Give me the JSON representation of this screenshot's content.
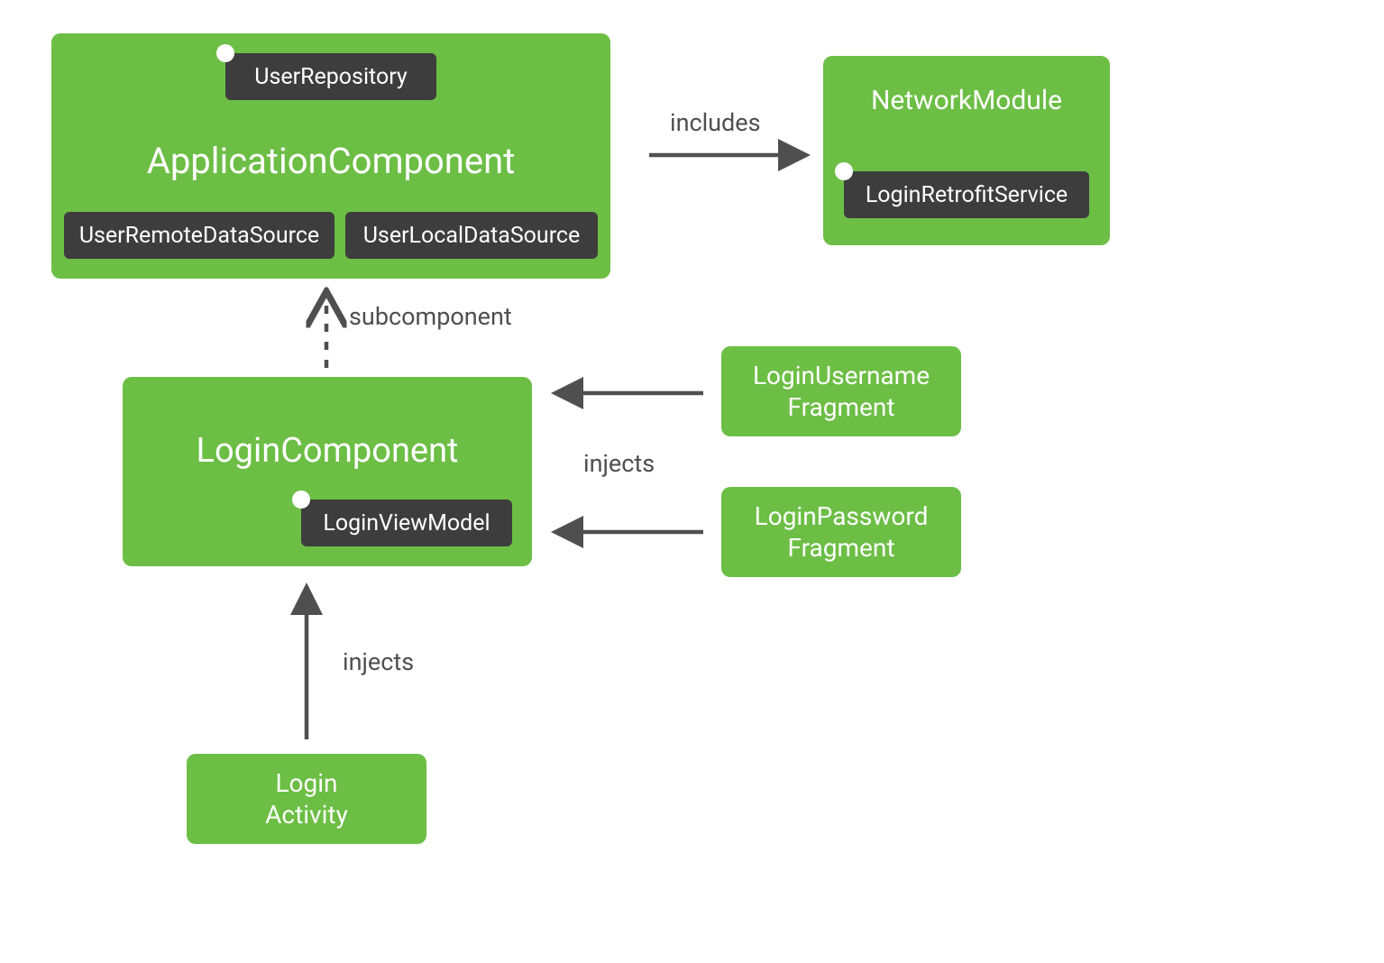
{
  "colors": {
    "green": "#6cbe45",
    "chip": "#3d3d3d",
    "label": "#4f4f4f",
    "arrow": "#4f4f4f"
  },
  "nodes": {
    "applicationComponent": {
      "title": "ApplicationComponent",
      "chips": {
        "userRepository": "UserRepository",
        "userRemoteDataSource": "UserRemoteDataSource",
        "userLocalDataSource": "UserLocalDataSource"
      }
    },
    "networkModule": {
      "title": "NetworkModule",
      "chips": {
        "loginRetrofitService": "LoginRetrofitService"
      }
    },
    "loginComponent": {
      "title": "LoginComponent",
      "chips": {
        "loginViewModel": "LoginViewModel"
      }
    },
    "loginUsernameFragment": {
      "line1": "LoginUsername",
      "line2": "Fragment"
    },
    "loginPasswordFragment": {
      "line1": "LoginPassword",
      "line2": "Fragment"
    },
    "loginActivity": {
      "line1": "Login",
      "line2": "Activity"
    }
  },
  "edges": {
    "includes": "includes",
    "subcomponent": "subcomponent",
    "injectsFragments": "injects",
    "injectsActivity": "injects"
  }
}
